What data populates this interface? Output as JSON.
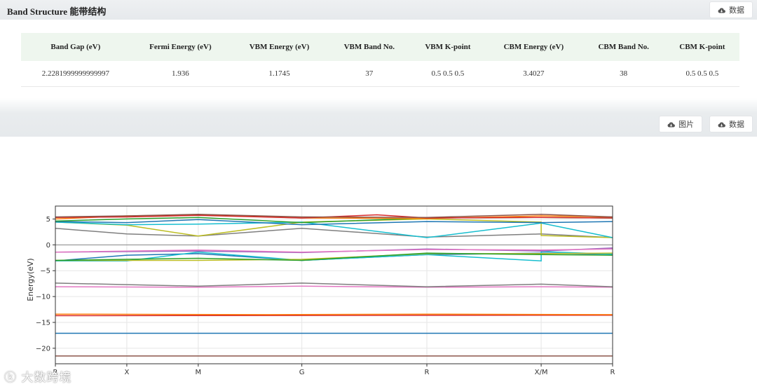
{
  "header": {
    "title": "Band Structure 能带结构",
    "data_btn": "数据"
  },
  "summary_table": {
    "columns": [
      "Band Gap (eV)",
      "Fermi Energy (eV)",
      "VBM Energy (eV)",
      "VBM Band No.",
      "VBM K-point",
      "CBM Energy (eV)",
      "CBM Band No.",
      "CBM K-point"
    ],
    "row": [
      "2.2281999999999997",
      "1.936",
      "1.1745",
      "37",
      "0.5 0.5 0.5",
      "3.4027",
      "38",
      "0.5 0.5 0.5"
    ]
  },
  "toolbar": {
    "image_btn": "图片",
    "data_btn": "数据"
  },
  "watermark": "大数跨境",
  "chart_data": {
    "type": "line",
    "ylabel": "Energy(eV)",
    "ylim": [
      -23,
      7.5
    ],
    "yticks": [
      5,
      0,
      -5,
      -10,
      -15,
      -20
    ],
    "k_labels": [
      "R",
      "X",
      "M",
      "G",
      "R",
      "X/M",
      "R"
    ],
    "k_positions": [
      0,
      1,
      2,
      3.45,
      5.2,
      6.8,
      7.8
    ],
    "series": [
      {
        "color": "#8c564b",
        "points": [
          [
            0,
            -21.5
          ],
          [
            7.8,
            -21.5
          ]
        ]
      },
      {
        "color": "#1f77b4",
        "points": [
          [
            0,
            -17.1
          ],
          [
            7.8,
            -17.1
          ]
        ]
      },
      {
        "color": "#d62728",
        "points": [
          [
            0,
            -13.7
          ],
          [
            7.8,
            -13.6
          ]
        ]
      },
      {
        "color": "#ff7f0e",
        "points": [
          [
            0,
            -13.4
          ],
          [
            3,
            -13.5
          ],
          [
            5.2,
            -13.4
          ],
          [
            7.8,
            -13.5
          ]
        ]
      },
      {
        "color": "#e377c2",
        "points": [
          [
            0,
            -8.1
          ],
          [
            2,
            -8.2
          ],
          [
            3.45,
            -8.0
          ],
          [
            5.2,
            -8.2
          ],
          [
            6.8,
            -8.1
          ],
          [
            7.8,
            -8.2
          ]
        ]
      },
      {
        "color": "#7f7f7f",
        "points": [
          [
            0,
            -7.4
          ],
          [
            2,
            -8.0
          ],
          [
            3.45,
            -7.4
          ],
          [
            5.2,
            -8.1
          ],
          [
            6.8,
            -7.6
          ],
          [
            7.8,
            -8.1
          ]
        ]
      },
      {
        "color": "#1f77b4",
        "points": [
          [
            0,
            -3.1
          ],
          [
            1,
            -2.0
          ],
          [
            2,
            -1.7
          ],
          [
            3.45,
            -3.0
          ],
          [
            5.2,
            -1.9
          ],
          [
            6.8,
            -1.6
          ],
          [
            7.8,
            -1.8
          ]
        ]
      },
      {
        "color": "#17becf",
        "points": [
          [
            0,
            -3.1
          ],
          [
            1,
            -3.1
          ],
          [
            2,
            -1.4
          ],
          [
            3.45,
            -3.0
          ],
          [
            5.2,
            -1.9
          ],
          [
            6.8,
            -3.1
          ],
          [
            6.8,
            -1.3
          ],
          [
            7.8,
            -1.8
          ]
        ]
      },
      {
        "color": "#bcbd22",
        "points": [
          [
            0,
            -3.0
          ],
          [
            2,
            -3.0
          ],
          [
            3.45,
            -2.8
          ],
          [
            5.2,
            -1.7
          ],
          [
            6.8,
            -1.7
          ],
          [
            7.8,
            -1.6
          ]
        ]
      },
      {
        "color": "#2ca02c",
        "points": [
          [
            0,
            -3.0
          ],
          [
            2,
            -2.6
          ],
          [
            3.45,
            -3.0
          ],
          [
            5.2,
            -1.6
          ],
          [
            6.8,
            -1.9
          ],
          [
            7.8,
            -2.0
          ]
        ]
      },
      {
        "color": "#9467bd",
        "points": [
          [
            0,
            -1.4
          ],
          [
            2,
            -1.2
          ],
          [
            3.45,
            -1.5
          ],
          [
            5.2,
            -0.8
          ],
          [
            6.8,
            -1.2
          ],
          [
            7.8,
            -0.6
          ]
        ]
      },
      {
        "color": "#e377c2",
        "points": [
          [
            0,
            -1.4
          ],
          [
            2,
            -1.0
          ],
          [
            3.45,
            -1.4
          ],
          [
            5.2,
            -0.9
          ],
          [
            6.8,
            -1.0
          ],
          [
            7.8,
            -0.8
          ]
        ]
      },
      {
        "color": "#7f7f7f",
        "points": [
          [
            0,
            3.2
          ],
          [
            1,
            2.1
          ],
          [
            2,
            1.7
          ],
          [
            3.45,
            3.2
          ],
          [
            5.2,
            1.5
          ],
          [
            6.8,
            2.1
          ],
          [
            7.8,
            1.4
          ]
        ]
      },
      {
        "color": "#bcbd22",
        "points": [
          [
            0,
            4.4
          ],
          [
            1,
            3.8
          ],
          [
            2,
            1.7
          ],
          [
            3.45,
            4.4
          ],
          [
            5.2,
            5.0
          ],
          [
            6.8,
            4.4
          ],
          [
            6.8,
            1.8
          ],
          [
            7.8,
            1.4
          ]
        ]
      },
      {
        "color": "#17becf",
        "points": [
          [
            0,
            4.4
          ],
          [
            1,
            3.9
          ],
          [
            2,
            4.0
          ],
          [
            3.45,
            4.4
          ],
          [
            5.2,
            1.4
          ],
          [
            6.8,
            4.2
          ],
          [
            7.8,
            1.4
          ]
        ]
      },
      {
        "color": "#1f77b4",
        "points": [
          [
            0,
            4.5
          ],
          [
            1,
            4.3
          ],
          [
            2,
            4.9
          ],
          [
            3.45,
            3.9
          ],
          [
            5.2,
            4.5
          ],
          [
            6.8,
            4.3
          ],
          [
            7.8,
            4.5
          ]
        ]
      },
      {
        "color": "#2ca02c",
        "points": [
          [
            0,
            4.6
          ],
          [
            1,
            5.0
          ],
          [
            2,
            5.3
          ],
          [
            3.45,
            4.3
          ],
          [
            5.2,
            5.2
          ],
          [
            6.8,
            5.3
          ],
          [
            7.8,
            5.2
          ]
        ]
      },
      {
        "color": "#ff7f0e",
        "points": [
          [
            0,
            5.0
          ],
          [
            1,
            5.6
          ],
          [
            2,
            5.8
          ],
          [
            3.45,
            5.2
          ],
          [
            5.2,
            5.1
          ],
          [
            6.8,
            5.6
          ],
          [
            7.8,
            5.4
          ]
        ]
      },
      {
        "color": "#d62728",
        "points": [
          [
            0,
            5.3
          ],
          [
            1,
            5.4
          ],
          [
            2,
            5.7
          ],
          [
            3.45,
            5.2
          ],
          [
            4.5,
            5.8
          ],
          [
            5.2,
            5.2
          ],
          [
            6.8,
            5.3
          ],
          [
            7.8,
            5.2
          ]
        ]
      },
      {
        "color": "#8c564b",
        "points": [
          [
            0,
            5.4
          ],
          [
            1,
            5.6
          ],
          [
            2,
            5.9
          ],
          [
            3.45,
            5.4
          ],
          [
            5.2,
            5.3
          ],
          [
            6.8,
            5.9
          ],
          [
            7.8,
            5.4
          ]
        ]
      }
    ]
  }
}
